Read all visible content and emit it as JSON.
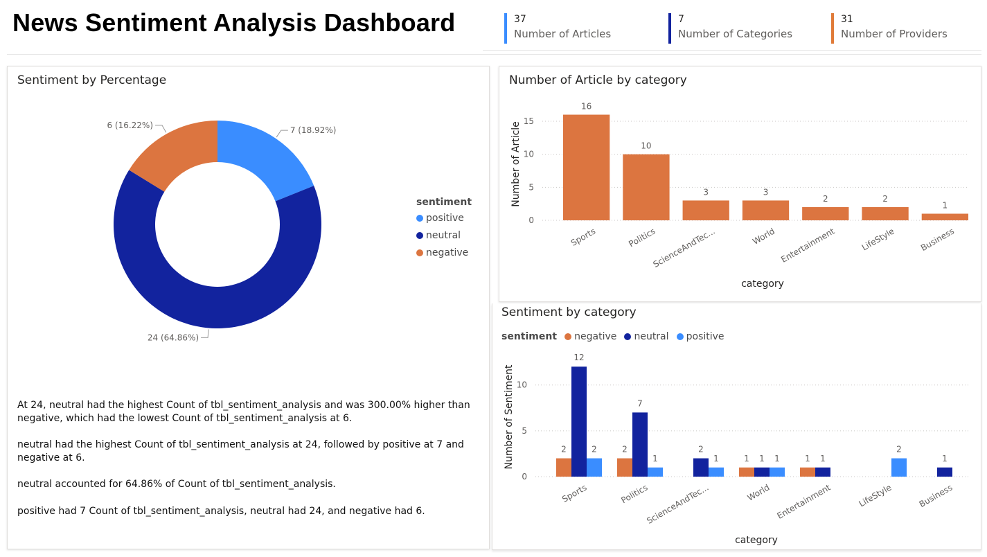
{
  "page": {
    "title": "News Sentiment Analysis Dashboard"
  },
  "kpis": [
    {
      "value": "37",
      "label": "Number of Articles",
      "color": "#3a8dff"
    },
    {
      "value": "7",
      "label": "Number of Categories",
      "color": "#12239e"
    },
    {
      "value": "31",
      "label": "Number of Providers",
      "color": "#e07b39"
    }
  ],
  "colors": {
    "positive": "#3a8dff",
    "neutral": "#12239e",
    "negative": "#dc7540"
  },
  "donut": {
    "title": "Sentiment by Percentage",
    "legend_title": "sentiment",
    "legend_items": [
      "positive",
      "neutral",
      "negative"
    ],
    "slice_labels": [
      "7 (18.92%)",
      "24 (64.86%)",
      "6 (16.22%)"
    ]
  },
  "narrative": [
    "At 24, neutral had the highest Count of tbl_sentiment_analysis and was 300.00% higher than negative, which had the lowest Count of tbl_sentiment_analysis at 6.",
    "neutral had the highest Count of tbl_sentiment_analysis at 24, followed by positive at 7 and negative at 6.",
    "neutral accounted for 64.86% of Count of tbl_sentiment_analysis.",
    "positive had 7 Count of tbl_sentiment_analysis, neutral had 24, and negative had 6."
  ],
  "bar_panel": {
    "title": "Number of Article by category"
  },
  "cluster_panel": {
    "title": "Sentiment by category",
    "legend_title": "sentiment",
    "legend_items": [
      "negative",
      "neutral",
      "positive"
    ]
  },
  "chart_data": [
    {
      "type": "pie",
      "title": "Sentiment by Percentage",
      "categories": [
        "positive",
        "neutral",
        "negative"
      ],
      "values": [
        7,
        24,
        6
      ],
      "legend": "right"
    },
    {
      "type": "bar",
      "title": "Number of Article by category",
      "categories": [
        "Sports",
        "Politics",
        "ScienceAndTec...",
        "World",
        "Entertainment",
        "LifeStyle",
        "Business"
      ],
      "values": [
        16,
        10,
        3,
        3,
        2,
        2,
        1
      ],
      "xlabel": "category",
      "ylabel": "Number of Article",
      "yticks": [
        "0",
        "5",
        "10",
        "15"
      ],
      "ylim": [
        0,
        17
      ],
      "grid": true
    },
    {
      "type": "bar",
      "title": "Sentiment by category",
      "categories": [
        "Sports",
        "Politics",
        "ScienceAndTec...",
        "World",
        "Entertainment",
        "LifeStyle",
        "Business"
      ],
      "series": [
        {
          "name": "negative",
          "values": [
            2,
            2,
            null,
            1,
            1,
            null,
            null
          ]
        },
        {
          "name": "neutral",
          "values": [
            12,
            7,
            2,
            1,
            1,
            null,
            1
          ]
        },
        {
          "name": "positive",
          "values": [
            2,
            1,
            1,
            1,
            null,
            2,
            null
          ]
        }
      ],
      "xlabel": "category",
      "ylabel": "Number of Sentiment",
      "yticks": [
        "0",
        "5",
        "10"
      ],
      "ylim": [
        0,
        13
      ],
      "legend": "top-left",
      "grid": true
    }
  ]
}
